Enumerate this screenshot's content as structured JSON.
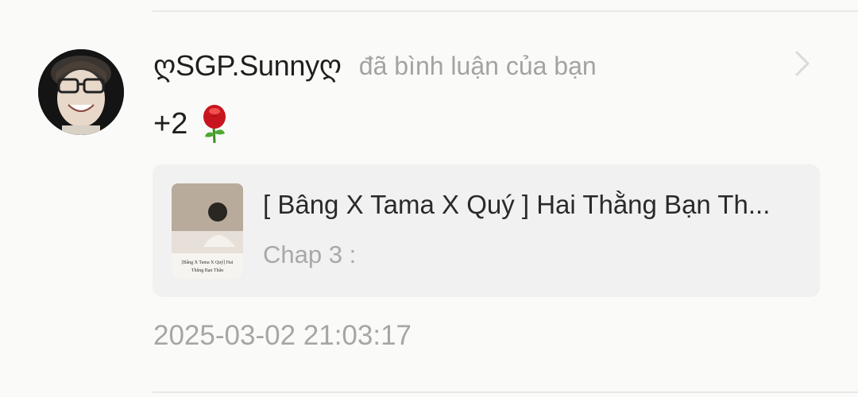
{
  "notification": {
    "user": {
      "name": "ღSGP.Sunnyღ",
      "avatar_icon": "user-avatar"
    },
    "action": "đã bình luận của bạn",
    "comment": {
      "text": "+2",
      "emoji_icon": "rose-icon"
    },
    "post": {
      "title": "[ Bâng X Tama X Quý ] Hai Thằng Bạn Th...",
      "subtitle": "Chap 3 :",
      "thumbnail_caption_line1": "[Bâng X Tama X Quý] Hai",
      "thumbnail_caption_line2": "Thằng Bạn Thân"
    },
    "timestamp": "2025-03-02 21:03:17"
  },
  "colors": {
    "background": "#fafaf8",
    "card": "#f1f1f1",
    "primary_text": "#1f1f1f",
    "secondary_text": "#a3a3a3",
    "rose": "#c8141e"
  }
}
